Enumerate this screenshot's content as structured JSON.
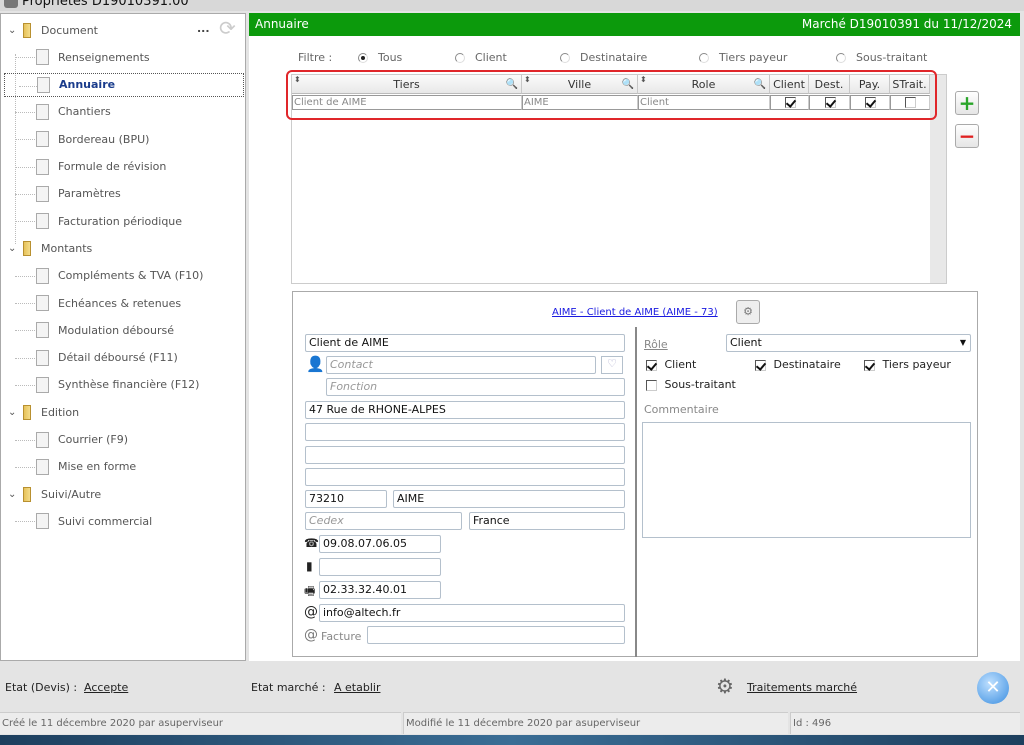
{
  "window": {
    "title": "Propriétés D19010391.00"
  },
  "sidebar": {
    "more_label": "...",
    "items": [
      {
        "label": "Document",
        "type": "group"
      },
      {
        "label": "Renseignements",
        "type": "leaf"
      },
      {
        "label": "Annuaire",
        "type": "leaf",
        "selected": true
      },
      {
        "label": "Chantiers",
        "type": "leaf"
      },
      {
        "label": "Bordereau (BPU)",
        "type": "leaf"
      },
      {
        "label": "Formule de révision",
        "type": "leaf"
      },
      {
        "label": "Paramètres",
        "type": "leaf"
      },
      {
        "label": "Facturation périodique",
        "type": "leaf"
      },
      {
        "label": "Montants",
        "type": "group"
      },
      {
        "label": "Compléments & TVA (F10)",
        "type": "leaf"
      },
      {
        "label": "Echéances & retenues",
        "type": "leaf"
      },
      {
        "label": "Modulation déboursé",
        "type": "leaf"
      },
      {
        "label": "Détail déboursé (F11)",
        "type": "leaf"
      },
      {
        "label": "Synthèse financière (F12)",
        "type": "leaf"
      },
      {
        "label": "Edition",
        "type": "group"
      },
      {
        "label": "Courrier (F9)",
        "type": "leaf"
      },
      {
        "label": "Mise en forme",
        "type": "leaf"
      },
      {
        "label": "Suivi/Autre",
        "type": "group"
      },
      {
        "label": "Suivi commercial",
        "type": "leaf"
      }
    ]
  },
  "header": {
    "title": "Annuaire",
    "right": "Marché D19010391 du 11/12/2024",
    "accent": "#0c9a0c"
  },
  "filter": {
    "label": "Filtre :",
    "options": [
      "Tous",
      "Client",
      "Destinataire",
      "Tiers payeur",
      "Sous-traitant"
    ],
    "selected": "Tous"
  },
  "grid": {
    "columns": [
      "Tiers",
      "Ville",
      "Role",
      "Client",
      "Dest.",
      "Pay.",
      "STrait."
    ],
    "rows": [
      {
        "tiers": "Client de AIME",
        "ville": "AIME",
        "role": "Client",
        "client": true,
        "dest": true,
        "pay": true,
        "strait": false
      }
    ]
  },
  "buttons": {
    "add": "+",
    "remove": "−"
  },
  "detail": {
    "link": "AIME - Client de AIME (AIME - 73)",
    "name": "Client de AIME",
    "contact_placeholder": "Contact",
    "fonction_placeholder": "Fonction",
    "address1": "47 Rue de RHONE-ALPES",
    "address2": "",
    "address3": "",
    "address4": "",
    "postcode": "73210",
    "city": "AIME",
    "cedex_placeholder": "Cedex",
    "country": "France",
    "phone": "09.08.07.06.05",
    "mobile": "",
    "fax": "02.33.32.40.01",
    "email": "info@altech.fr",
    "facture_label": "Facture",
    "facture_email": "",
    "role_label": "Rôle",
    "role_value": "Client",
    "checks": [
      {
        "label": "Client",
        "checked": true
      },
      {
        "label": "Destinataire",
        "checked": true
      },
      {
        "label": "Tiers payeur",
        "checked": true
      },
      {
        "label": "Sous-traitant",
        "checked": false
      }
    ],
    "comment_label": "Commentaire",
    "comment": ""
  },
  "footer": {
    "etat_devis_label": "Etat (Devis) :",
    "etat_devis": "Accepte",
    "etat_marche_label": "Etat marché :",
    "etat_marche": "A etablir",
    "traitements": "Traitements marché",
    "created": "Créé le 11 décembre 2020 par asuperviseur",
    "modified": "Modifié le 11 décembre 2020 par asuperviseur",
    "id": "Id : 496"
  }
}
